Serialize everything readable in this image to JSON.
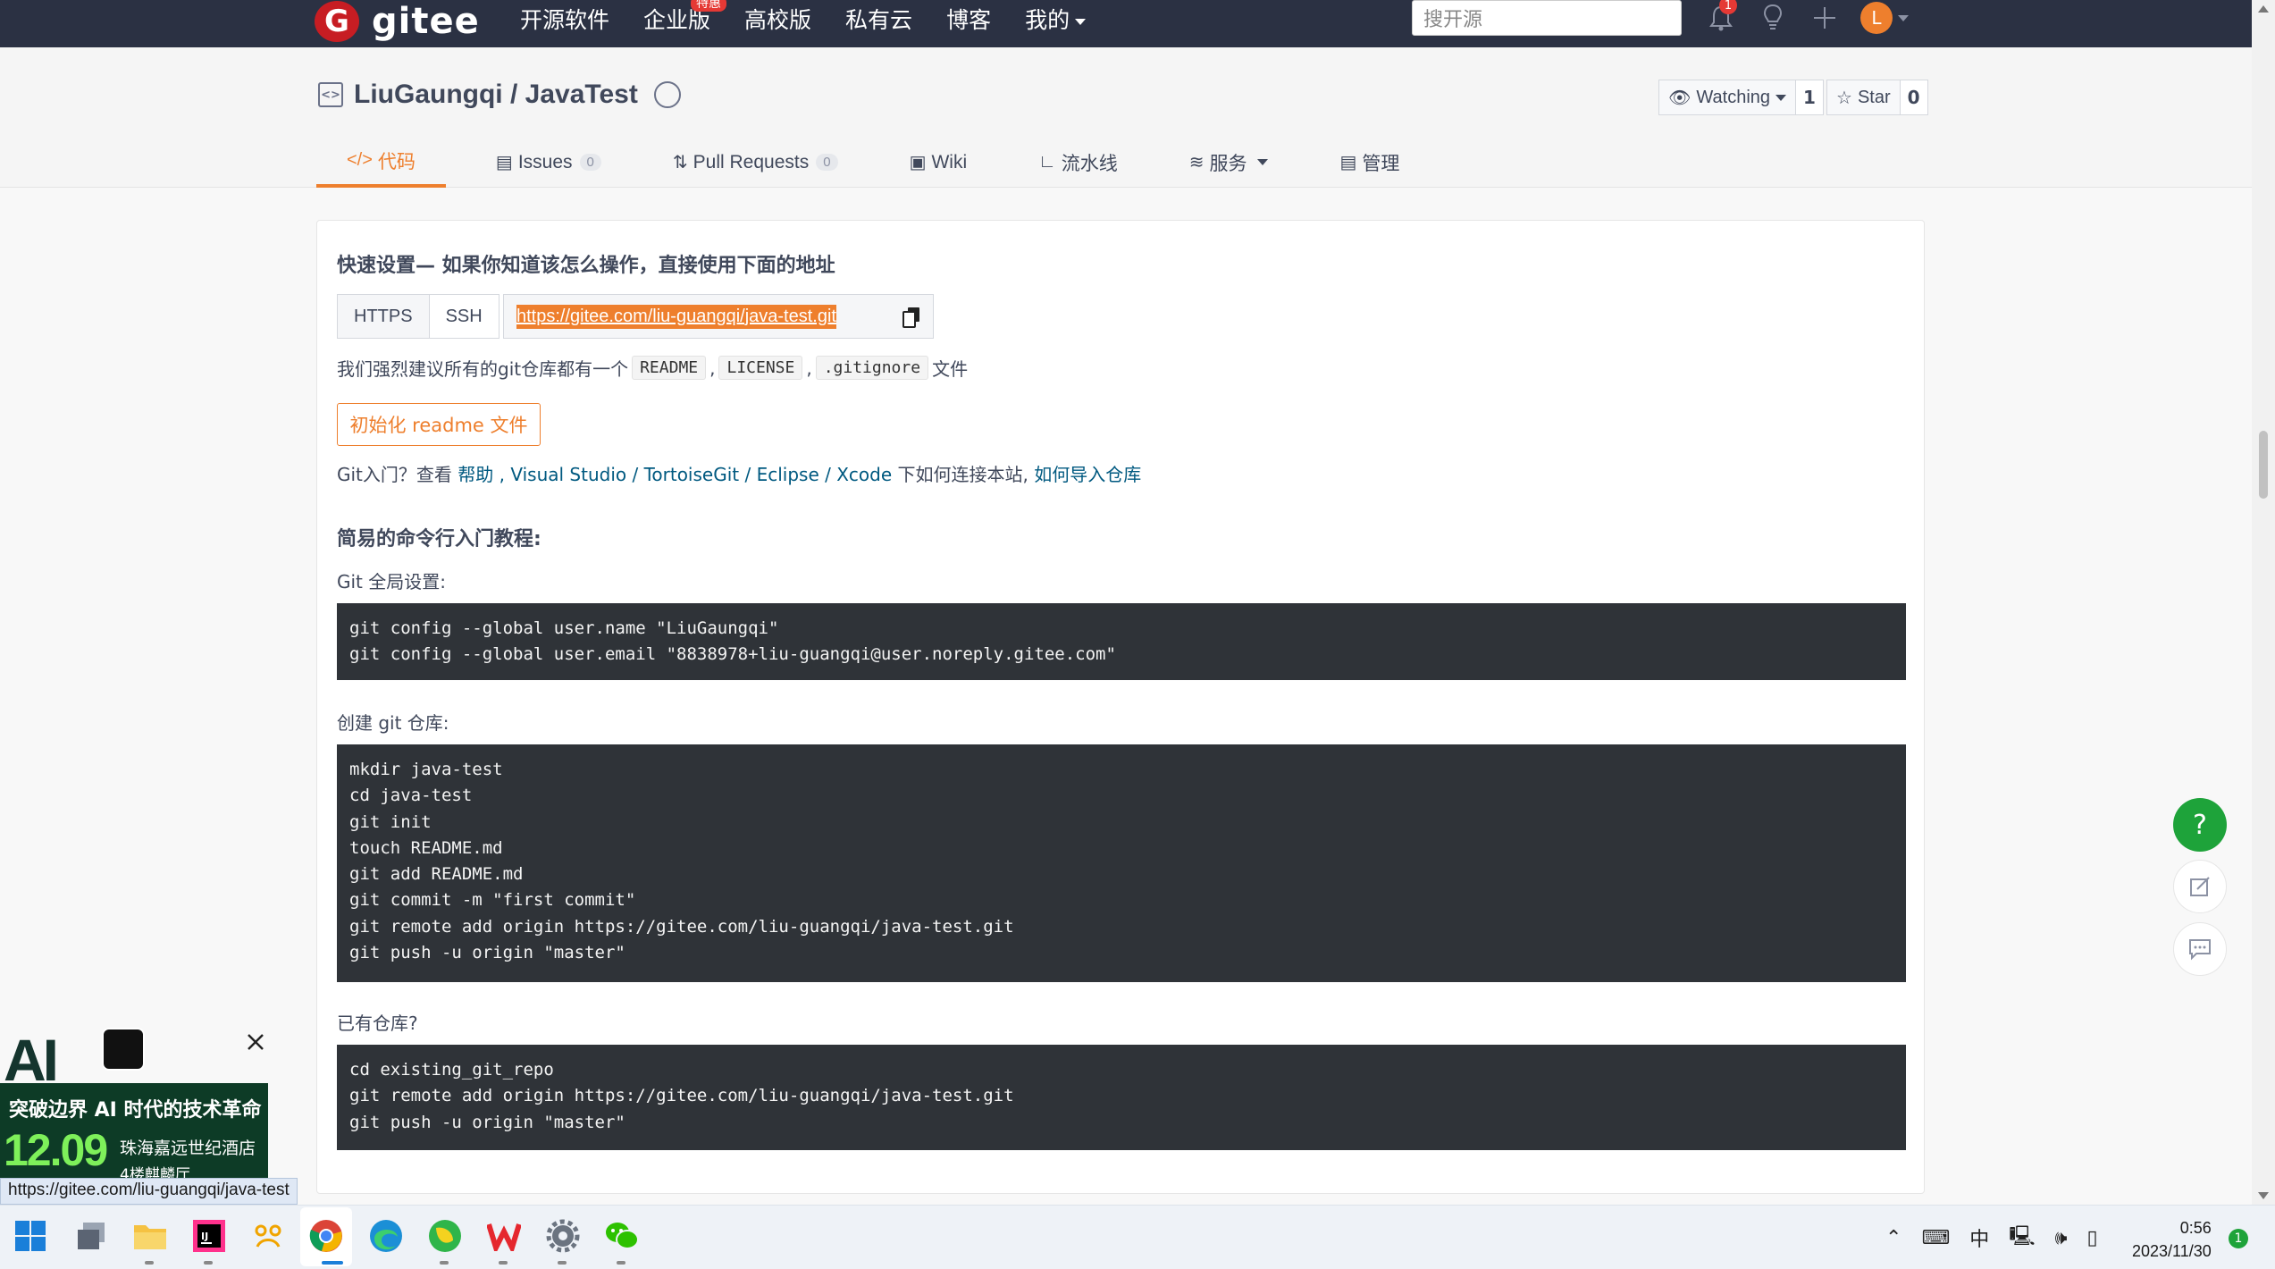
{
  "nav": {
    "logo_text": "gitee",
    "logo_badge": "G",
    "links": [
      "开源软件",
      "企业版",
      "高校版",
      "私有云",
      "博客",
      "我的"
    ],
    "hot_badge": "特惠",
    "search_placeholder": "搜开源",
    "notification_count": "1",
    "avatar_letter": "L"
  },
  "repo": {
    "title": "LiuGaungqi / JavaTest",
    "watch_label": "Watching",
    "watch_count": "1",
    "star_label": "Star",
    "star_count": "0"
  },
  "tabs": [
    {
      "label": "代码",
      "icon": "code-icon",
      "active": true
    },
    {
      "label": "Issues",
      "count": "0",
      "icon": "issues-icon"
    },
    {
      "label": "Pull Requests",
      "count": "0",
      "icon": "pull-request-icon"
    },
    {
      "label": "Wiki",
      "icon": "wiki-icon"
    },
    {
      "label": "流水线",
      "icon": "pipeline-icon"
    },
    {
      "label": "服务",
      "icon": "service-icon"
    },
    {
      "label": "管理",
      "icon": "manage-icon"
    }
  ],
  "quick": {
    "heading": "快速设置— 如果你知道该怎么操作，直接使用下面的地址",
    "https_label": "HTTPS",
    "ssh_label": "SSH",
    "url": "https://gitee.com/liu-guangqi/java-test.git",
    "recommend_prefix": "我们强烈建议所有的git仓库都有一个",
    "chip_readme": "README",
    "sep1": ",",
    "chip_license": "LICENSE",
    "sep2": ",",
    "chip_gitignore": ".gitignore",
    "recommend_suffix": "文件",
    "init_button": "初始化 readme 文件",
    "intro_prefix": "Git入门？查看",
    "intro_help": "帮助",
    "intro_sep1": ",",
    "intro_vs": "Visual Studio",
    "intro_slash1": "/",
    "intro_tgit": "TortoiseGit",
    "intro_slash2": "/",
    "intro_eclipse": "Eclipse",
    "intro_slash3": "/",
    "intro_xcode": "Xcode",
    "intro_mid": "下如何连接本站,",
    "intro_import": "如何导入仓库"
  },
  "tutorial": {
    "heading": "简易的命令行入门教程:",
    "global_label": "Git 全局设置:",
    "global_code": [
      "git config --global user.name \"LiuGaungqi\"",
      "git config --global user.email \"8838978+liu-guangqi@user.noreply.gitee.com\""
    ],
    "create_label": "创建 git 仓库:",
    "create_code": [
      "mkdir java-test",
      "cd java-test",
      "git init",
      "touch README.md",
      "git add README.md",
      "git commit -m \"first commit\"",
      "git remote add origin https://gitee.com/liu-guangqi/java-test.git",
      "git push -u origin \"master\""
    ],
    "existing_label": "已有仓库?",
    "existing_code": [
      "cd existing_git_repo",
      "git remote add origin https://gitee.com/liu-guangqi/java-test.git",
      "git push -u origin \"master\""
    ]
  },
  "ad": {
    "logo": "AI",
    "line1": "突破边界 AI 时代的技术革命",
    "date": "12.09",
    "place": "珠海嘉远世纪酒店",
    "hall": "4楼麒麟厅"
  },
  "status_url": "https://gitee.com/liu-guangqi/java-test",
  "float": {
    "help": "?"
  },
  "taskbar": {
    "tray_ime": "中",
    "time": "0:56",
    "date": "2023/11/30",
    "notif_count": "1"
  },
  "colors": {
    "nav_bg": "#2b3143",
    "accent": "#ee7f2d",
    "brand": "#c71d23",
    "link": "#005980",
    "code_bg": "#2f3338",
    "help_green": "#1ea33a"
  }
}
